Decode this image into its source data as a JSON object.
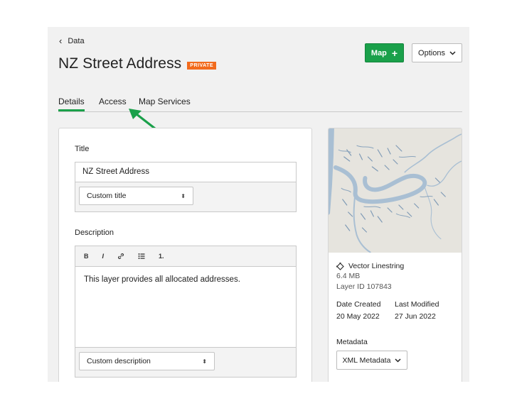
{
  "breadcrumb": {
    "label": "Data"
  },
  "header": {
    "title": "NZ Street Address",
    "badge": "PRIVATE"
  },
  "actions": {
    "map_label": "Map",
    "map_plus": "+",
    "options_label": "Options"
  },
  "tabs": [
    {
      "label": "Details",
      "active": true
    },
    {
      "label": "Access",
      "active": false
    },
    {
      "label": "Map Services",
      "active": false
    }
  ],
  "form": {
    "title_label": "Title",
    "title_value": "NZ Street Address",
    "title_select": "Custom title",
    "description_label": "Description",
    "toolbar": {
      "bold": "B",
      "italic": "I",
      "ordered_list": "1."
    },
    "description_value": "This layer provides all allocated addresses.",
    "description_select": "Custom description"
  },
  "info": {
    "geometry": "Vector Linestring",
    "size": "6.4 MB",
    "layer_id": "Layer ID 107843",
    "date_created_label": "Date Created",
    "date_created": "20 May 2022",
    "last_modified_label": "Last Modified",
    "last_modified": "27 Jun 2022",
    "metadata_label": "Metadata",
    "metadata_button": "XML Metadata"
  },
  "colors": {
    "accent": "#1aa04a",
    "badge": "#f26b1d",
    "river": "#a9bfd3"
  }
}
